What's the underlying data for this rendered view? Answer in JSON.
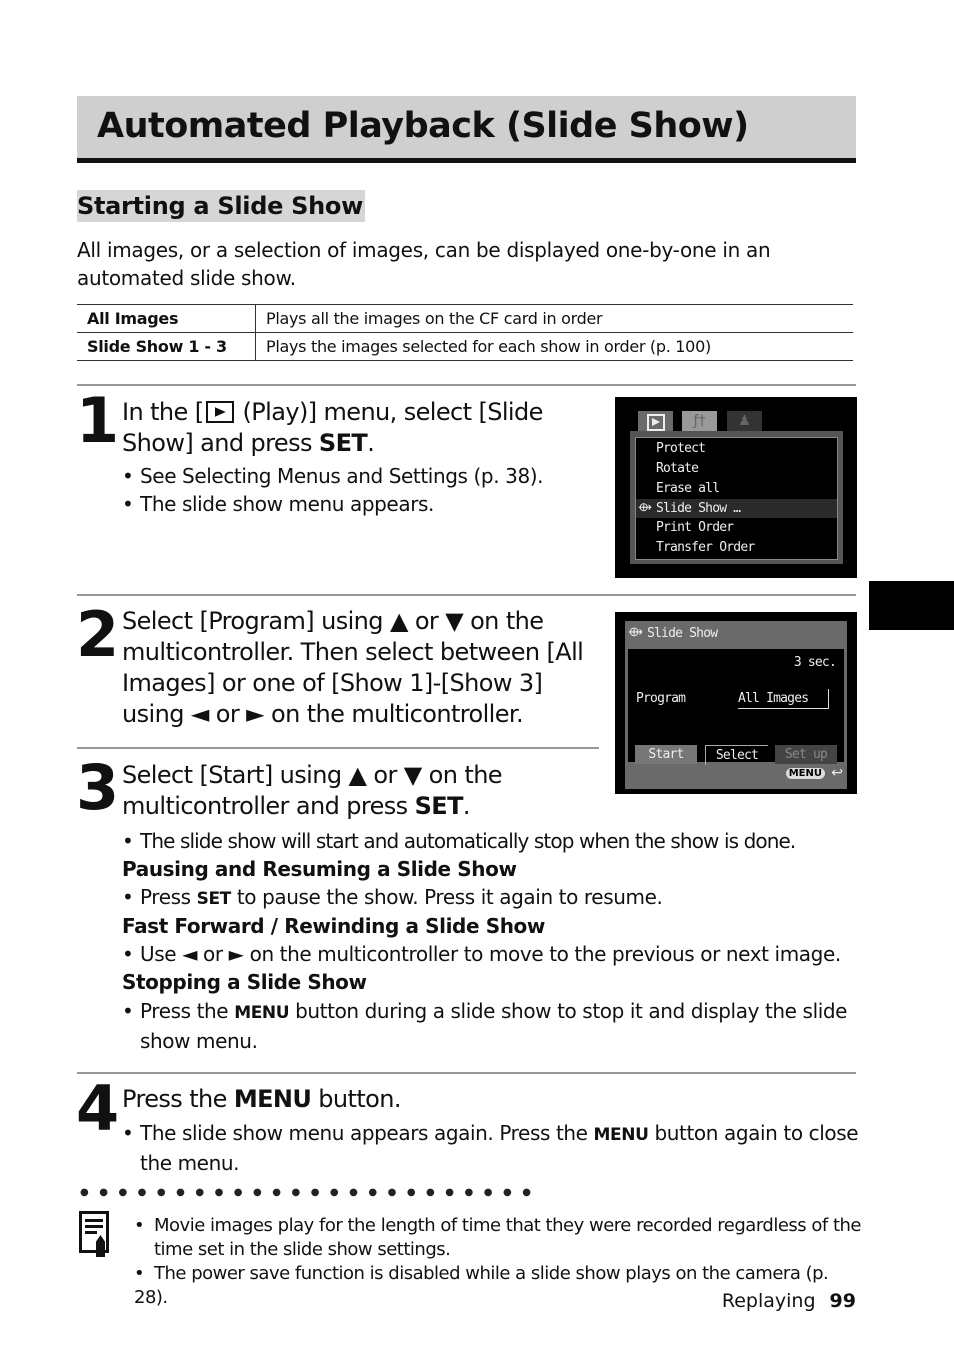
{
  "page_title": "Automated Playback (Slide Show)",
  "section_title": "Starting a Slide Show",
  "intro": "All images, or a selection of images, can be displayed one-by-one in an automated slide show.",
  "options_table": [
    {
      "key": "All Images",
      "desc": "Plays all the images on the CF card in order"
    },
    {
      "key": "Slide Show 1 - 3",
      "desc": "Plays the images selected for each show in order (p. 100)"
    }
  ],
  "steps": [
    {
      "number": "1",
      "heading_a": "In the [",
      "heading_b": " (Play)] menu, select [Slide Show] and press ",
      "heading_key": "SET",
      "heading_end": ".",
      "bullets": [
        "See Selecting Menus and Settings (p. 38).",
        "The slide show menu appears."
      ]
    },
    {
      "number": "2",
      "heading": "Select [Program] using ▲ or ▼ on the multicontroller. Then select between [All Images] or one of [Show 1]-[Show 3] using ◄ or ► on the multicontroller."
    },
    {
      "number": "3",
      "heading_a": "Select [Start] using ▲ or ▼ on the multicontroller and press ",
      "heading_key": "SET",
      "heading_end": ".",
      "bullet": "The slide show will start and automatically stop when the show is done.",
      "subsections": [
        {
          "title": "Pausing and Resuming a Slide Show",
          "pre": "Press ",
          "key": "SET",
          "post": " to pause the show. Press it again to resume."
        },
        {
          "title": "Fast Forward / Rewinding a Slide Show",
          "pre": "Use ◄ or ► on the multicontroller to move to the previous or next image.",
          "key": "",
          "post": ""
        },
        {
          "title": "Stopping a Slide Show",
          "pre": "Press the ",
          "key": "MENU",
          "post": " button during a slide show to stop it and display the slide show menu."
        }
      ]
    },
    {
      "number": "4",
      "heading_a": "Press the ",
      "heading_key": "MENU",
      "heading_end": " button.",
      "bullet_pre": "The slide show menu appears again. Press the ",
      "bullet_key": "MENU",
      "bullet_post": " button again to close the menu."
    }
  ],
  "lcd_play_menu": {
    "tabs": [
      "play-tab",
      "setup-tab",
      "mycamera-tab"
    ],
    "items": [
      "Protect",
      "Rotate",
      "Erase all",
      "Slide Show …",
      "Print Order",
      "Transfer Order"
    ],
    "selected_index": 3
  },
  "lcd_slideshow": {
    "title": "Slide Show",
    "interval": "3 sec.",
    "program_label": "Program",
    "program_value": "All Images",
    "buttons": [
      "Start",
      "Select",
      "Set up"
    ],
    "menu_label": "MENU"
  },
  "notes": [
    "Movie images play for the length of time that they were recorded regardless of the time set in the slide show settings.",
    "The power save function is disabled while a slide show plays on the camera (p. 28)."
  ],
  "footer": {
    "chapter": "Replaying",
    "page": "99"
  }
}
